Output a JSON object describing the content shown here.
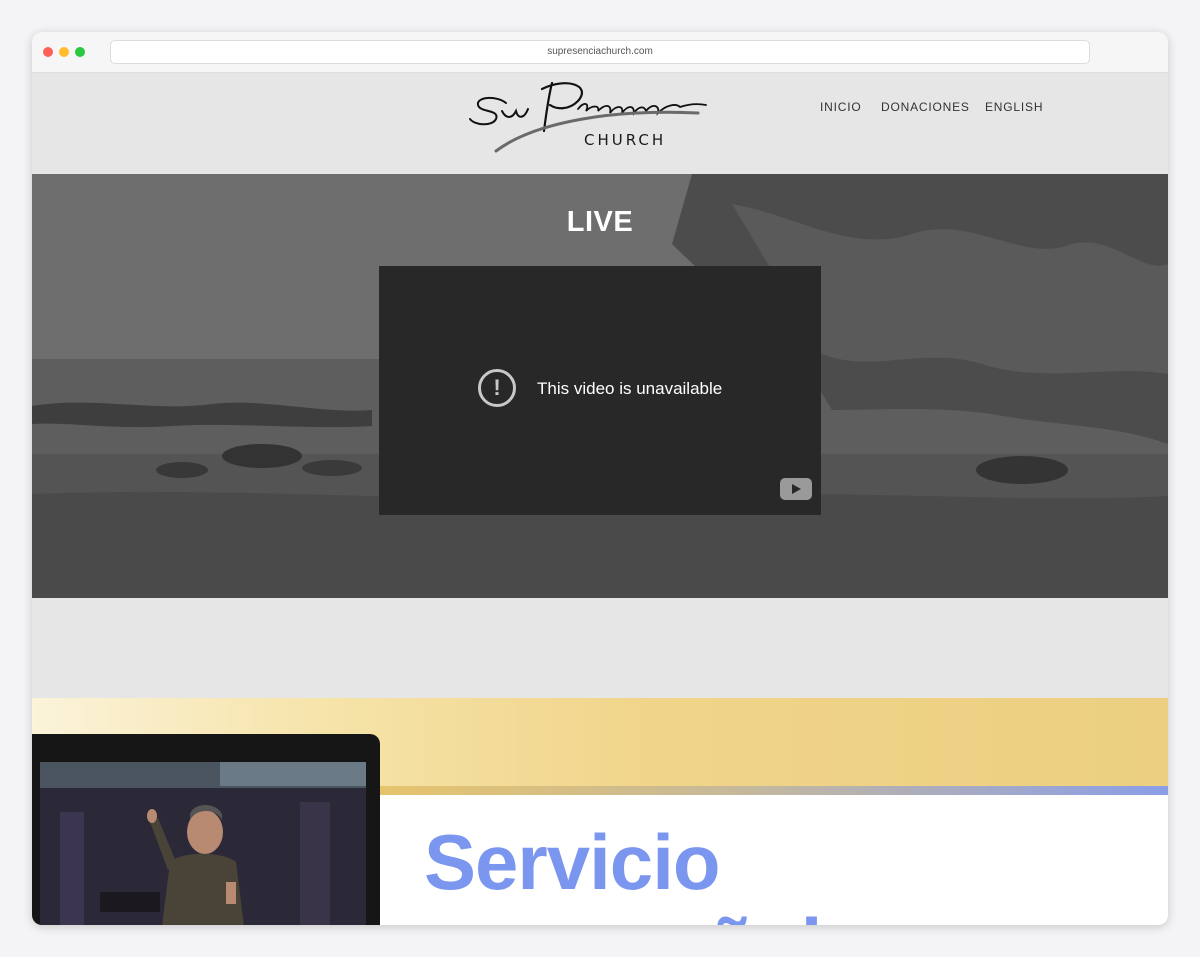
{
  "browser": {
    "url": "supresenciachurch.com"
  },
  "header": {
    "logo_script": "Su Presencia",
    "logo_sub": "CHURCH",
    "nav": [
      {
        "label": "INICIO"
      },
      {
        "label": "DONACIONES"
      },
      {
        "label": "ENGLISH"
      }
    ]
  },
  "live_section": {
    "title": "LIVE",
    "player_message": "This video is unavailable",
    "warning_glyph": "!"
  },
  "promo": {
    "title_line1": "Servicio",
    "title_line2": "en español",
    "accent_color": "#7b96ee"
  },
  "colors": {
    "page_bg": "#e6e6e6",
    "player_bg": "#282828",
    "promo_yellow": "#f2d98a"
  }
}
